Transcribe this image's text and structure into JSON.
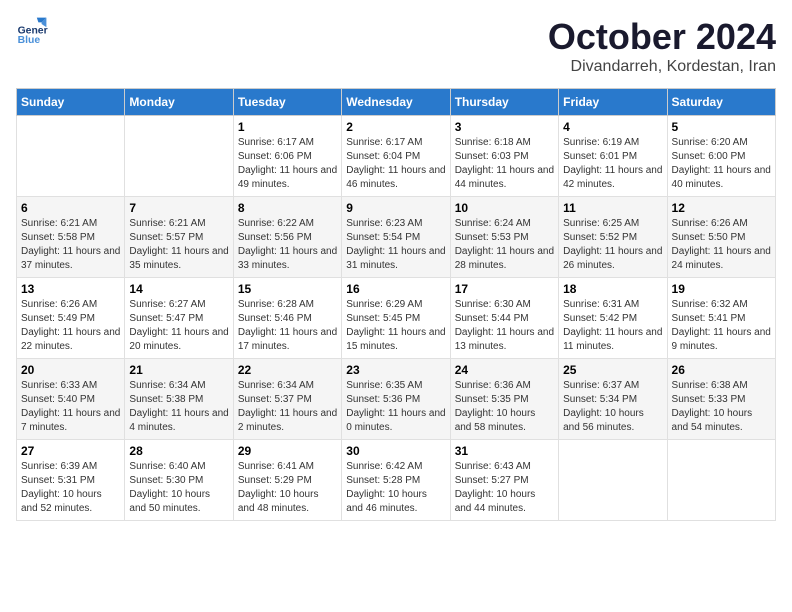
{
  "header": {
    "logo_line1": "General",
    "logo_line2": "Blue",
    "month": "October 2024",
    "location": "Divandarreh, Kordestan, Iran"
  },
  "weekdays": [
    "Sunday",
    "Monday",
    "Tuesday",
    "Wednesday",
    "Thursday",
    "Friday",
    "Saturday"
  ],
  "weeks": [
    [
      {
        "day": "",
        "sunrise": "",
        "sunset": "",
        "daylight": ""
      },
      {
        "day": "",
        "sunrise": "",
        "sunset": "",
        "daylight": ""
      },
      {
        "day": "1",
        "sunrise": "Sunrise: 6:17 AM",
        "sunset": "Sunset: 6:06 PM",
        "daylight": "Daylight: 11 hours and 49 minutes."
      },
      {
        "day": "2",
        "sunrise": "Sunrise: 6:17 AM",
        "sunset": "Sunset: 6:04 PM",
        "daylight": "Daylight: 11 hours and 46 minutes."
      },
      {
        "day": "3",
        "sunrise": "Sunrise: 6:18 AM",
        "sunset": "Sunset: 6:03 PM",
        "daylight": "Daylight: 11 hours and 44 minutes."
      },
      {
        "day": "4",
        "sunrise": "Sunrise: 6:19 AM",
        "sunset": "Sunset: 6:01 PM",
        "daylight": "Daylight: 11 hours and 42 minutes."
      },
      {
        "day": "5",
        "sunrise": "Sunrise: 6:20 AM",
        "sunset": "Sunset: 6:00 PM",
        "daylight": "Daylight: 11 hours and 40 minutes."
      }
    ],
    [
      {
        "day": "6",
        "sunrise": "Sunrise: 6:21 AM",
        "sunset": "Sunset: 5:58 PM",
        "daylight": "Daylight: 11 hours and 37 minutes."
      },
      {
        "day": "7",
        "sunrise": "Sunrise: 6:21 AM",
        "sunset": "Sunset: 5:57 PM",
        "daylight": "Daylight: 11 hours and 35 minutes."
      },
      {
        "day": "8",
        "sunrise": "Sunrise: 6:22 AM",
        "sunset": "Sunset: 5:56 PM",
        "daylight": "Daylight: 11 hours and 33 minutes."
      },
      {
        "day": "9",
        "sunrise": "Sunrise: 6:23 AM",
        "sunset": "Sunset: 5:54 PM",
        "daylight": "Daylight: 11 hours and 31 minutes."
      },
      {
        "day": "10",
        "sunrise": "Sunrise: 6:24 AM",
        "sunset": "Sunset: 5:53 PM",
        "daylight": "Daylight: 11 hours and 28 minutes."
      },
      {
        "day": "11",
        "sunrise": "Sunrise: 6:25 AM",
        "sunset": "Sunset: 5:52 PM",
        "daylight": "Daylight: 11 hours and 26 minutes."
      },
      {
        "day": "12",
        "sunrise": "Sunrise: 6:26 AM",
        "sunset": "Sunset: 5:50 PM",
        "daylight": "Daylight: 11 hours and 24 minutes."
      }
    ],
    [
      {
        "day": "13",
        "sunrise": "Sunrise: 6:26 AM",
        "sunset": "Sunset: 5:49 PM",
        "daylight": "Daylight: 11 hours and 22 minutes."
      },
      {
        "day": "14",
        "sunrise": "Sunrise: 6:27 AM",
        "sunset": "Sunset: 5:47 PM",
        "daylight": "Daylight: 11 hours and 20 minutes."
      },
      {
        "day": "15",
        "sunrise": "Sunrise: 6:28 AM",
        "sunset": "Sunset: 5:46 PM",
        "daylight": "Daylight: 11 hours and 17 minutes."
      },
      {
        "day": "16",
        "sunrise": "Sunrise: 6:29 AM",
        "sunset": "Sunset: 5:45 PM",
        "daylight": "Daylight: 11 hours and 15 minutes."
      },
      {
        "day": "17",
        "sunrise": "Sunrise: 6:30 AM",
        "sunset": "Sunset: 5:44 PM",
        "daylight": "Daylight: 11 hours and 13 minutes."
      },
      {
        "day": "18",
        "sunrise": "Sunrise: 6:31 AM",
        "sunset": "Sunset: 5:42 PM",
        "daylight": "Daylight: 11 hours and 11 minutes."
      },
      {
        "day": "19",
        "sunrise": "Sunrise: 6:32 AM",
        "sunset": "Sunset: 5:41 PM",
        "daylight": "Daylight: 11 hours and 9 minutes."
      }
    ],
    [
      {
        "day": "20",
        "sunrise": "Sunrise: 6:33 AM",
        "sunset": "Sunset: 5:40 PM",
        "daylight": "Daylight: 11 hours and 7 minutes."
      },
      {
        "day": "21",
        "sunrise": "Sunrise: 6:34 AM",
        "sunset": "Sunset: 5:38 PM",
        "daylight": "Daylight: 11 hours and 4 minutes."
      },
      {
        "day": "22",
        "sunrise": "Sunrise: 6:34 AM",
        "sunset": "Sunset: 5:37 PM",
        "daylight": "Daylight: 11 hours and 2 minutes."
      },
      {
        "day": "23",
        "sunrise": "Sunrise: 6:35 AM",
        "sunset": "Sunset: 5:36 PM",
        "daylight": "Daylight: 11 hours and 0 minutes."
      },
      {
        "day": "24",
        "sunrise": "Sunrise: 6:36 AM",
        "sunset": "Sunset: 5:35 PM",
        "daylight": "Daylight: 10 hours and 58 minutes."
      },
      {
        "day": "25",
        "sunrise": "Sunrise: 6:37 AM",
        "sunset": "Sunset: 5:34 PM",
        "daylight": "Daylight: 10 hours and 56 minutes."
      },
      {
        "day": "26",
        "sunrise": "Sunrise: 6:38 AM",
        "sunset": "Sunset: 5:33 PM",
        "daylight": "Daylight: 10 hours and 54 minutes."
      }
    ],
    [
      {
        "day": "27",
        "sunrise": "Sunrise: 6:39 AM",
        "sunset": "Sunset: 5:31 PM",
        "daylight": "Daylight: 10 hours and 52 minutes."
      },
      {
        "day": "28",
        "sunrise": "Sunrise: 6:40 AM",
        "sunset": "Sunset: 5:30 PM",
        "daylight": "Daylight: 10 hours and 50 minutes."
      },
      {
        "day": "29",
        "sunrise": "Sunrise: 6:41 AM",
        "sunset": "Sunset: 5:29 PM",
        "daylight": "Daylight: 10 hours and 48 minutes."
      },
      {
        "day": "30",
        "sunrise": "Sunrise: 6:42 AM",
        "sunset": "Sunset: 5:28 PM",
        "daylight": "Daylight: 10 hours and 46 minutes."
      },
      {
        "day": "31",
        "sunrise": "Sunrise: 6:43 AM",
        "sunset": "Sunset: 5:27 PM",
        "daylight": "Daylight: 10 hours and 44 minutes."
      },
      {
        "day": "",
        "sunrise": "",
        "sunset": "",
        "daylight": ""
      },
      {
        "day": "",
        "sunrise": "",
        "sunset": "",
        "daylight": ""
      }
    ]
  ]
}
